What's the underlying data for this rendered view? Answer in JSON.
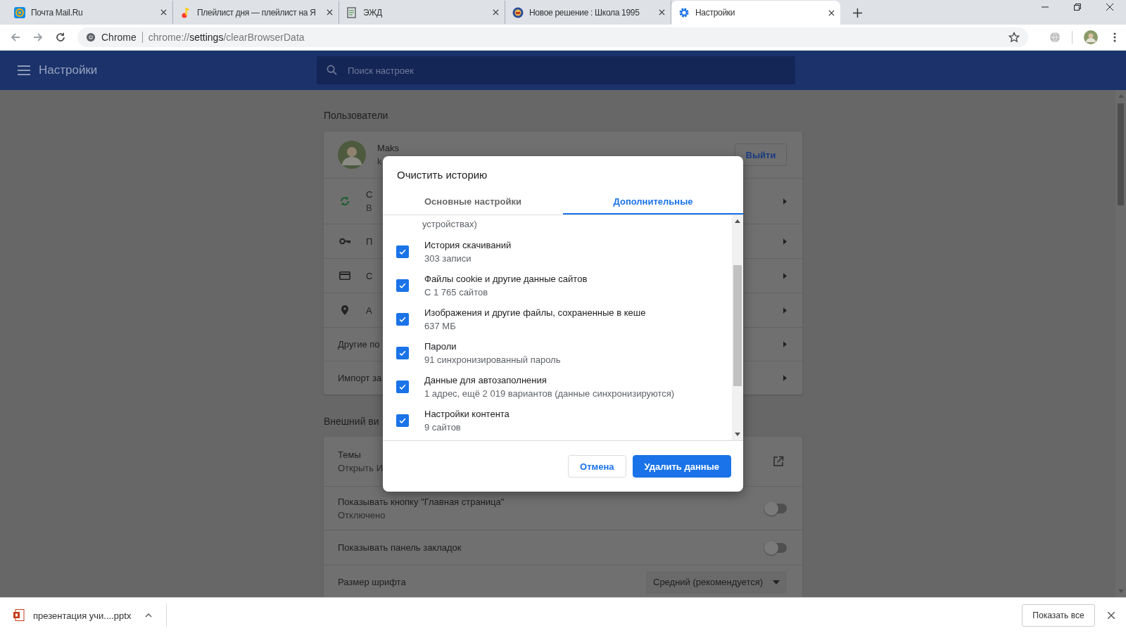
{
  "browser_tabs": [
    {
      "kind": "mail",
      "title": "Почта Mail.Ru",
      "selected": false
    },
    {
      "kind": "music",
      "title": "Плейлист дня — плейлист на Я",
      "selected": false
    },
    {
      "kind": "document",
      "title": "ЭЖД",
      "selected": false
    },
    {
      "kind": "school",
      "title": "Новое решение : Школа 1995",
      "selected": false
    },
    {
      "kind": "settings",
      "title": "Настройки",
      "selected": true
    }
  ],
  "address_bar": {
    "site_label": "Chrome",
    "url_prefix": "chrome://",
    "url_host": "settings",
    "url_path": "/clearBrowserData"
  },
  "header": {
    "title": "Настройки",
    "search_placeholder": "Поиск настроек"
  },
  "people": {
    "heading": "Пользователи",
    "profile": {
      "name": "Maks",
      "email": "k"
    },
    "sign_out": "Выйти",
    "rows": [
      {
        "kind": "sync",
        "label": "С",
        "sublabel": "В"
      },
      {
        "kind": "key",
        "label": "П"
      },
      {
        "kind": "card",
        "label": "С"
      },
      {
        "kind": "pin",
        "label": "А"
      },
      {
        "kind": "plain",
        "label": "Другие по"
      },
      {
        "kind": "plain",
        "label": "Импорт за"
      }
    ]
  },
  "appearance": {
    "heading": "Внешний ви",
    "rows": [
      {
        "kind": "link",
        "label": "Темы",
        "sublabel": "Открыть И"
      },
      {
        "kind": "toggle",
        "label": "Показывать кнопку \"Главная страница\"",
        "sublabel": "Отключено",
        "on": false
      },
      {
        "kind": "toggle",
        "label": "Показывать панель закладок",
        "on": false
      },
      {
        "kind": "select",
        "label": "Размер шрифта",
        "value": "Средний (рекомендуется)"
      }
    ]
  },
  "dialog": {
    "title": "Очистить историю",
    "tabs": [
      {
        "label": "Основные настройки",
        "selected": false
      },
      {
        "label": "Дополнительные",
        "selected": true
      }
    ],
    "items": [
      {
        "kind": "partial",
        "sublabel": "устройствах)"
      },
      {
        "kind": "full",
        "label": "История скачиваний",
        "sublabel": "303 записи",
        "checked": true
      },
      {
        "kind": "full",
        "label": "Файлы cookie и другие данные сайтов",
        "sublabel": "С 1 765 сайтов",
        "checked": true
      },
      {
        "kind": "full",
        "label": "Изображения и другие файлы, сохраненные в кеше",
        "sublabel": "637 МБ",
        "checked": true
      },
      {
        "kind": "full",
        "label": "Пароли",
        "sublabel": "91 синхронизированный пароль",
        "checked": true
      },
      {
        "kind": "full",
        "label": "Данные для автозаполнения",
        "sublabel": "1 адрес, ещё 2 019 вариантов (данные синхронизируются)",
        "checked": true
      },
      {
        "kind": "full",
        "label": "Настройки контента",
        "sublabel": "9 сайтов",
        "checked": true
      }
    ],
    "buttons": [
      {
        "kind": "secondary",
        "label": "Отмена"
      },
      {
        "kind": "primary",
        "label": "Удалить данные"
      }
    ]
  },
  "downloads": {
    "items": [
      {
        "name": "презентация учи....pptx"
      }
    ],
    "show_all": "Показать все"
  }
}
